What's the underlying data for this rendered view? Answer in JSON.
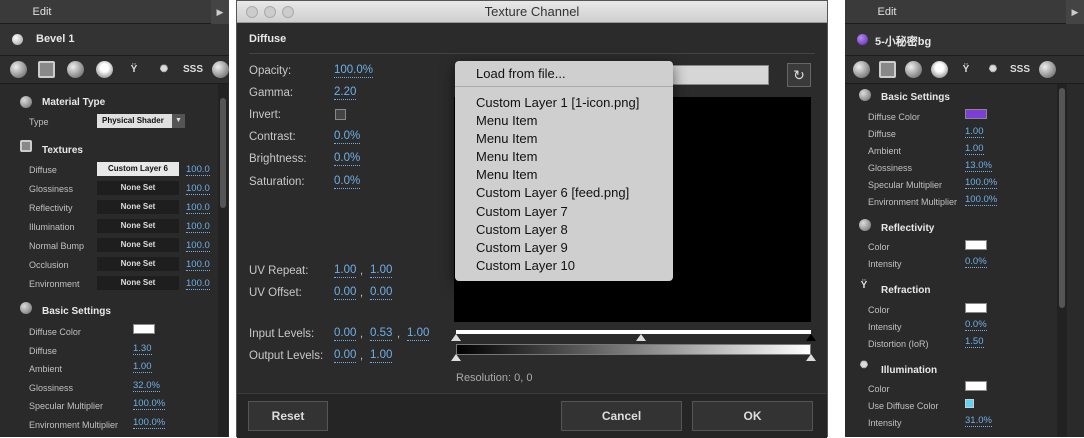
{
  "left_panel": {
    "tab": "Edit",
    "material_name": "Bevel 1",
    "icons": [
      "diffuse-sphere-icon",
      "texture-image-icon",
      "reflect-sphere-icon",
      "lock-icon",
      "refraction-glass-icon",
      "illumination-bulb-icon",
      "SSS",
      "globe-icon"
    ],
    "material_type": {
      "heading": "Material Type",
      "type_label": "Type",
      "type_value": "Physical Shader"
    },
    "textures": {
      "heading": "Textures",
      "rows": [
        {
          "label": "Diffuse",
          "slot": "Custom Layer 6",
          "value": "100.0"
        },
        {
          "label": "Glossiness",
          "slot": "None Set",
          "value": "100.0"
        },
        {
          "label": "Reflectivity",
          "slot": "None Set",
          "value": "100.0"
        },
        {
          "label": "Illumination",
          "slot": "None Set",
          "value": "100.0"
        },
        {
          "label": "Normal Bump",
          "slot": "None Set",
          "value": "100.0"
        },
        {
          "label": "Occlusion",
          "slot": "None Set",
          "value": "100.0"
        },
        {
          "label": "Environment",
          "slot": "None Set",
          "value": "100.0"
        }
      ]
    },
    "basic": {
      "heading": "Basic Settings",
      "diffuse_color_label": "Diffuse Color",
      "diffuse_color": "#ffffff",
      "rows": [
        {
          "label": "Diffuse",
          "value": "1.30"
        },
        {
          "label": "Ambient",
          "value": "1.00"
        },
        {
          "label": "Glossiness",
          "value": "32.0%"
        },
        {
          "label": "Specular Multiplier",
          "value": "100.0%"
        },
        {
          "label": "Environment Multiplier",
          "value": "100.0%"
        }
      ]
    }
  },
  "dialog": {
    "title": "Texture Channel",
    "section": "Diffuse",
    "params": [
      {
        "label": "Opacity:",
        "value": "100.0%"
      },
      {
        "label": "Gamma:",
        "value": "2.20"
      },
      {
        "label": "Invert:",
        "value": ""
      },
      {
        "label": "Contrast:",
        "value": "0.0%"
      },
      {
        "label": "Brightness:",
        "value": "0.0%"
      },
      {
        "label": "Saturation:",
        "value": "0.0%"
      }
    ],
    "uv_repeat": {
      "label": "UV Repeat:",
      "u": "1.00",
      "v": "1.00"
    },
    "uv_offset": {
      "label": "UV Offset:",
      "u": "0.00",
      "v": "0.00"
    },
    "input_levels": {
      "label": "Input Levels:",
      "low": "0.00",
      "mid": "0.53",
      "high": "1.00"
    },
    "output_levels": {
      "label": "Output Levels:",
      "low": "0.00",
      "high": "1.00"
    },
    "separator": ",",
    "resolution": "Resolution: 0, 0",
    "reset_label": "Reset",
    "cancel_label": "Cancel",
    "ok_label": "OK",
    "menu": {
      "load": "Load from file...",
      "items": [
        "Custom Layer 1 [1-icon.png]",
        "Menu Item",
        "Menu Item",
        "Menu Item",
        "Menu Item",
        "Custom Layer 6 [feed.png]",
        "Custom Layer 7",
        "Custom Layer 8",
        "Custom Layer 9",
        "Custom Layer 10"
      ]
    }
  },
  "right_panel": {
    "tab": "Edit",
    "material_name": "5-小秘密bg",
    "material_color": "#7b3fd6",
    "basic": {
      "heading": "Basic Settings",
      "diffuse_color_label": "Diffuse Color",
      "diffuse_color": "#7b3fd6",
      "rows": [
        {
          "label": "Diffuse",
          "value": "1.00"
        },
        {
          "label": "Ambient",
          "value": "1.00"
        },
        {
          "label": "Glossiness",
          "value": "13.0%"
        },
        {
          "label": "Specular Multiplier",
          "value": "100.0%"
        },
        {
          "label": "Environment Multiplier",
          "value": "100.0%"
        }
      ]
    },
    "reflectivity": {
      "heading": "Reflectivity",
      "color_label": "Color",
      "intensity_label": "Intensity",
      "intensity": "0.0%"
    },
    "refraction": {
      "heading": "Refraction",
      "color_label": "Color",
      "intensity_label": "Intensity",
      "intensity": "0.0%",
      "distortion_label": "Distortion (IoR)",
      "distortion": "1.50"
    },
    "illumination": {
      "heading": "Illumination",
      "color_label": "Color",
      "use_diffuse_label": "Use Diffuse Color",
      "intensity_label": "Intensity",
      "intensity": "31.0%"
    }
  }
}
